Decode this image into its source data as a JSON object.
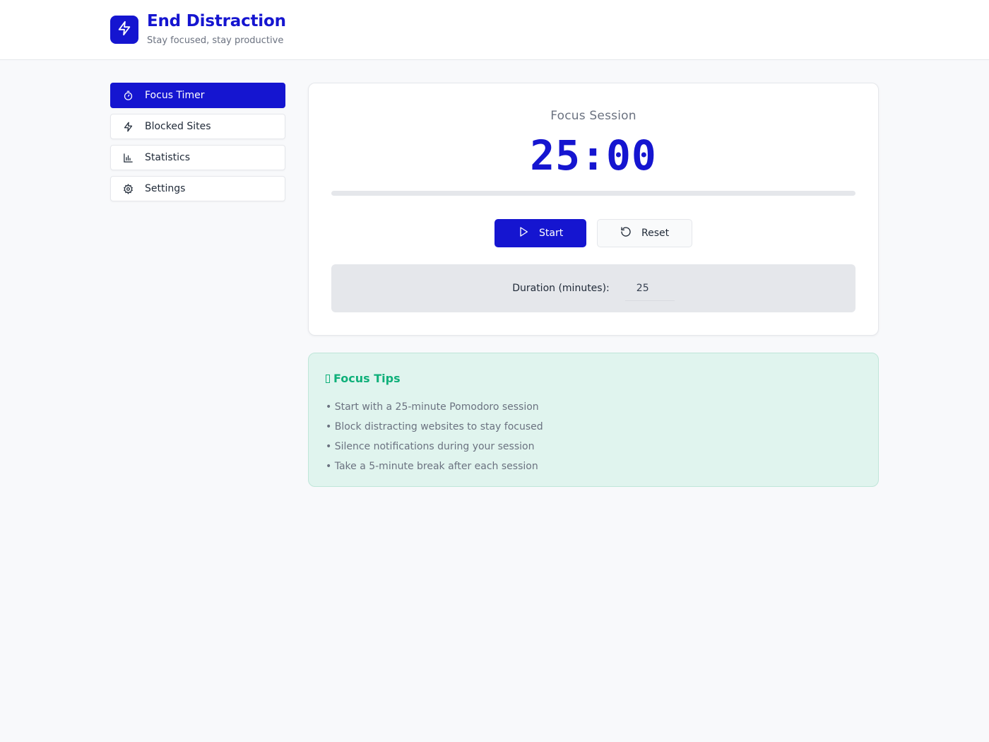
{
  "colors": {
    "accent": "#1515d0",
    "tip_accent": "#10b07a"
  },
  "header": {
    "logo_icon": "lightning-icon",
    "title": "End Distraction",
    "subtitle": "Stay focused, stay productive"
  },
  "sidebar": {
    "items": [
      {
        "label": "Focus Timer",
        "icon": "timer-icon",
        "active": true
      },
      {
        "label": "Blocked Sites",
        "icon": "lightning-icon",
        "active": false
      },
      {
        "label": "Statistics",
        "icon": "bar-chart-icon",
        "active": false
      },
      {
        "label": "Settings",
        "icon": "gear-icon",
        "active": false
      }
    ]
  },
  "timer": {
    "session_label": "Focus Session",
    "display": "25:00",
    "progress": 0,
    "start_label": "Start",
    "reset_label": "Reset",
    "duration_label": "Duration (minutes):",
    "duration_value": "25"
  },
  "tips": {
    "title": "Focus Tips",
    "items": [
      "• Start with a 25-minute Pomodoro session",
      "• Block distracting websites to stay focused",
      "• Silence notifications during your session",
      "• Take a 5-minute break after each session"
    ]
  }
}
